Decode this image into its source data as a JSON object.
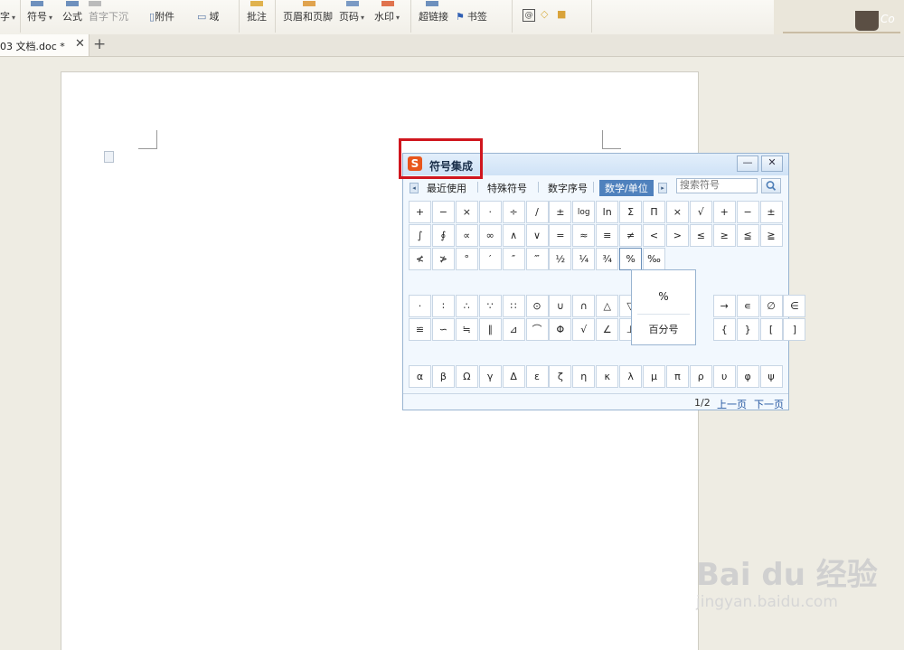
{
  "toolbar": {
    "items": [
      {
        "label": "字",
        "caret": "▾"
      },
      {
        "label": "符号",
        "caret": "▾"
      },
      {
        "label": "公式"
      },
      {
        "label": "首字下沉"
      },
      {
        "label": "附件"
      },
      {
        "label": "域"
      },
      {
        "label": "批注"
      },
      {
        "label": "页眉和页脚"
      },
      {
        "label": "页码",
        "caret": "▾"
      },
      {
        "label": "水印",
        "caret": "▾"
      },
      {
        "label": "超链接"
      },
      {
        "label": "书签"
      }
    ],
    "deco_text": "Co"
  },
  "tabs": {
    "doc_tab": "03 文档.doc *",
    "close": "✕",
    "add": "+"
  },
  "dialog": {
    "title": "符号集成",
    "logo": "S",
    "minimize": "—",
    "close": "✕",
    "categories": [
      "最近使用",
      "特殊符号",
      "数字序号",
      "数学/单位"
    ],
    "active_category": "数学/单位",
    "search_placeholder": "搜索符号",
    "grid1": [
      [
        "+",
        "−",
        "×",
        "·",
        "÷",
        "∕",
        "±",
        "log",
        "ln",
        "Σ",
        "Π",
        "×",
        "√",
        "+",
        "−",
        "±"
      ],
      [
        "∫",
        "∮",
        "∝",
        "∞",
        "∧",
        "∨",
        "=",
        "≈",
        "≡",
        "≠",
        "<",
        ">",
        "≤",
        "≥",
        "≦",
        "≧"
      ],
      [
        "≮",
        "≯",
        "°",
        "′",
        "″",
        "‴",
        "½",
        "¼",
        "¾",
        "%",
        "‰"
      ]
    ],
    "grid2": [
      [
        "·",
        "∶",
        "∴",
        "∵",
        "∷",
        "⊙",
        "∪",
        "∩",
        "△",
        "▽",
        "",
        "",
        "",
        "→",
        "∊",
        "∅",
        "∈"
      ],
      [
        "≌",
        "∽",
        "≒",
        "∥",
        "⊿",
        "⌒",
        "Φ",
        "√",
        "∠",
        "⊥",
        "",
        "",
        "",
        "{",
        "}",
        "[",
        "]"
      ]
    ],
    "grid3": [
      "α",
      "β",
      "Ω",
      "γ",
      "Δ",
      "ε",
      "ζ",
      "η",
      "κ",
      "λ",
      "μ",
      "π",
      "ρ",
      "υ",
      "φ",
      "ψ"
    ],
    "popup": {
      "symbol": "%",
      "name": "百分号"
    },
    "footer": {
      "page": "1/2",
      "prev": "上一页",
      "next": "下一页"
    }
  },
  "watermark": {
    "baidu": "Bai du 经验",
    "url": "jingyan.baidu.com"
  }
}
